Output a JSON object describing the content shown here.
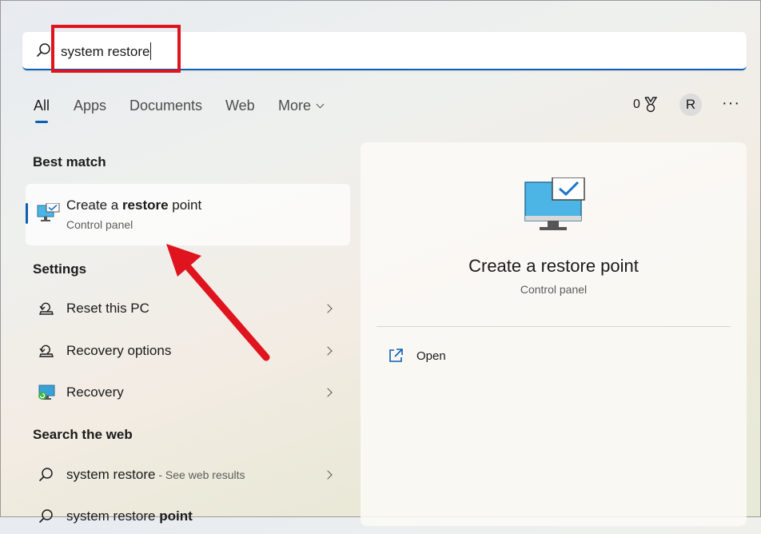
{
  "search": {
    "value": "system restore"
  },
  "tabs": [
    {
      "label": "All"
    },
    {
      "label": "Apps"
    },
    {
      "label": "Documents"
    },
    {
      "label": "Web"
    },
    {
      "label": "More"
    }
  ],
  "header": {
    "rewards_count": "0",
    "avatar_initial": "R",
    "more_label": "···"
  },
  "best_match": {
    "section_title": "Best match",
    "title_prefix": "Create a ",
    "title_bold": "restore",
    "title_suffix": " point",
    "subtitle": "Control panel"
  },
  "settings": {
    "section_title": "Settings",
    "items": [
      {
        "label": "Reset this PC",
        "icon": "reset-pc-icon"
      },
      {
        "label": "Recovery options",
        "icon": "recovery-options-icon"
      },
      {
        "label": "Recovery",
        "icon": "recovery-icon"
      }
    ]
  },
  "web": {
    "section_title": "Search the web",
    "items": [
      {
        "label": "system restore",
        "suffix": " - See web results"
      },
      {
        "label_prefix": "system restore ",
        "label_bold": "point"
      }
    ]
  },
  "preview": {
    "title": "Create a restore point",
    "subtitle": "Control panel",
    "action_label": "Open"
  },
  "colors": {
    "accent": "#0a5fb4",
    "annotation": "#e0141e"
  }
}
